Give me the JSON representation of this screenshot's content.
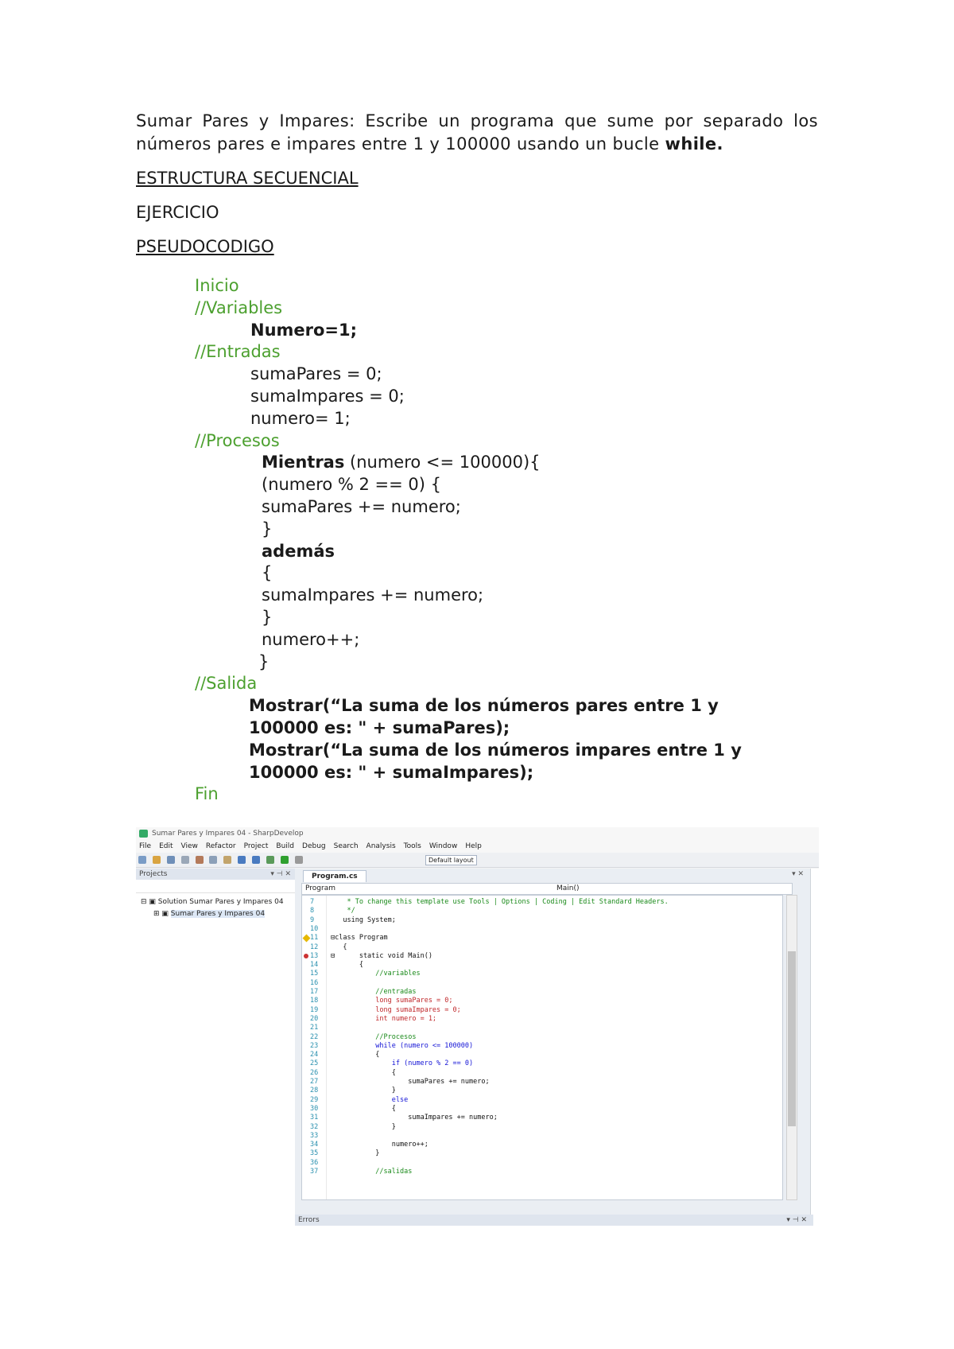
{
  "intro": {
    "text": "Sumar Pares y Impares: Escribe un programa que sume por separado los números pares e impares entre 1 y 100000 usando un bucle ",
    "bold_end": "while."
  },
  "headings": {
    "estructura": "ESTRUCTURA SECUENCIAL",
    "ejercicio": "EJERCICIO",
    "pseudocodigo": "PSEUDOCODIGO"
  },
  "pseudocode": {
    "inicio": "Inicio",
    "variables_comment": "//Variables",
    "numero_decl": "Numero=1;",
    "entradas_comment": "//Entradas",
    "sumapares": "sumaPares = 0;",
    "sumaimpares": "sumaImpares = 0;",
    "numero_init": "numero= 1;",
    "procesos_comment": "//Procesos",
    "mientras_kw": "Mientras",
    "mientras_cond": " (numero <= 100000){",
    "if_cond": "(numero % 2 == 0) {",
    "sumapares_add": "sumaPares += numero;",
    "close1": "}",
    "ademas": "además",
    "open2": "{",
    "sumaimpares_add": "sumaImpares += numero;",
    "close2": "}",
    "numero_inc": "numero++;",
    "close3": "}",
    "salida_comment": "//Salida",
    "mostrar1_a": "Mostrar(“La suma de los números pares entre 1 y",
    "mostrar1_b": "100000 es: \" + sumaPares);",
    "mostrar2_a": "Mostrar(“La suma de los números impares entre 1 y",
    "mostrar2_b": "100000 es: \" + sumaImpares);",
    "fin": "Fin"
  },
  "ide": {
    "title": "Sumar Pares y Impares 04 - SharpDevelop",
    "menu": [
      "File",
      "Edit",
      "View",
      "Refactor",
      "Project",
      "Build",
      "Debug",
      "Search",
      "Analysis",
      "Tools",
      "Window",
      "Help"
    ],
    "layout": "Default layout",
    "projects_panel": "Projects",
    "panel_controls": "▾ ⊣ ✕",
    "solution": "Solution Sumar Pares y Impares 04",
    "project": "Sumar Pares y Impares 04",
    "tab": "Program.cs",
    "nav_class": "Program",
    "nav_method": "Main()",
    "errors_panel": "Errors",
    "code_lines": [
      {
        "n": "7",
        "t": "    * To change this template use Tools | Options | Coding | Edit Standard Headers.",
        "c": "green"
      },
      {
        "n": "8",
        "t": "    */",
        "c": "green"
      },
      {
        "n": "9",
        "t": "   using System;",
        "c": "plain"
      },
      {
        "n": "10",
        "t": "",
        "c": "plain"
      },
      {
        "n": "11",
        "t": "⊟class Program",
        "c": "plain"
      },
      {
        "n": "12",
        "t": "   {",
        "c": "plain"
      },
      {
        "n": "13",
        "t": "⊟      static void Main()",
        "c": "plain"
      },
      {
        "n": "14",
        "t": "       {",
        "c": "plain"
      },
      {
        "n": "15",
        "t": "           //variables",
        "c": "green"
      },
      {
        "n": "16",
        "t": "",
        "c": "plain"
      },
      {
        "n": "17",
        "t": "           //entradas",
        "c": "green"
      },
      {
        "n": "18",
        "t": "           long sumaPares = 0;",
        "c": "red"
      },
      {
        "n": "19",
        "t": "           long sumaImpares = 0;",
        "c": "red"
      },
      {
        "n": "20",
        "t": "           int numero = 1;",
        "c": "red"
      },
      {
        "n": "21",
        "t": "",
        "c": "plain"
      },
      {
        "n": "22",
        "t": "           //Procesos",
        "c": "green"
      },
      {
        "n": "23",
        "t": "           while (numero <= 100000)",
        "c": "blue"
      },
      {
        "n": "24",
        "t": "           {",
        "c": "plain"
      },
      {
        "n": "25",
        "t": "               if (numero % 2 == 0)",
        "c": "blue"
      },
      {
        "n": "26",
        "t": "               {",
        "c": "plain"
      },
      {
        "n": "27",
        "t": "                   sumaPares += numero;",
        "c": "plain"
      },
      {
        "n": "28",
        "t": "               }",
        "c": "plain"
      },
      {
        "n": "29",
        "t": "               else",
        "c": "blue"
      },
      {
        "n": "30",
        "t": "               {",
        "c": "plain"
      },
      {
        "n": "31",
        "t": "                   sumaImpares += numero;",
        "c": "plain"
      },
      {
        "n": "32",
        "t": "               }",
        "c": "plain"
      },
      {
        "n": "33",
        "t": "",
        "c": "plain"
      },
      {
        "n": "34",
        "t": "               numero++;",
        "c": "plain"
      },
      {
        "n": "35",
        "t": "           }",
        "c": "plain"
      },
      {
        "n": "36",
        "t": "",
        "c": "plain"
      },
      {
        "n": "37",
        "t": "           //salidas",
        "c": "green"
      }
    ]
  }
}
